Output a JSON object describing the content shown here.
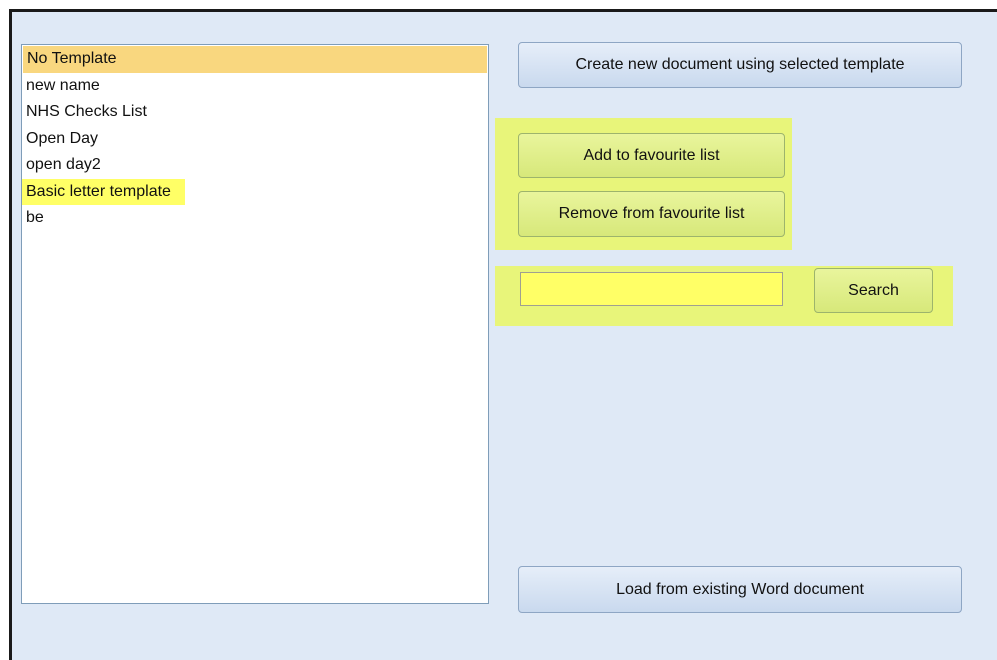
{
  "templates": {
    "items": [
      {
        "label": "No Template",
        "state": "selected"
      },
      {
        "label": "new name",
        "state": "normal"
      },
      {
        "label": "NHS Checks List",
        "state": "normal"
      },
      {
        "label": "Open Day",
        "state": "normal"
      },
      {
        "label": "open day2",
        "state": "normal"
      },
      {
        "label": "Basic letter template",
        "state": "highlighted"
      },
      {
        "label": "be",
        "state": "normal"
      }
    ]
  },
  "actions": {
    "create_label": "Create new document using selected template",
    "add_favourite_label": "Add to favourite list",
    "remove_favourite_label": "Remove from favourite list",
    "search_label": "Search",
    "load_word_label": "Load from existing Word document"
  },
  "search": {
    "value": "",
    "placeholder": ""
  },
  "colors": {
    "panel_background": "#dfe9f6",
    "selected_item": "#f9d77f",
    "highlight_yellow": "#ffff66",
    "highlight_box": "#e8f57a"
  }
}
